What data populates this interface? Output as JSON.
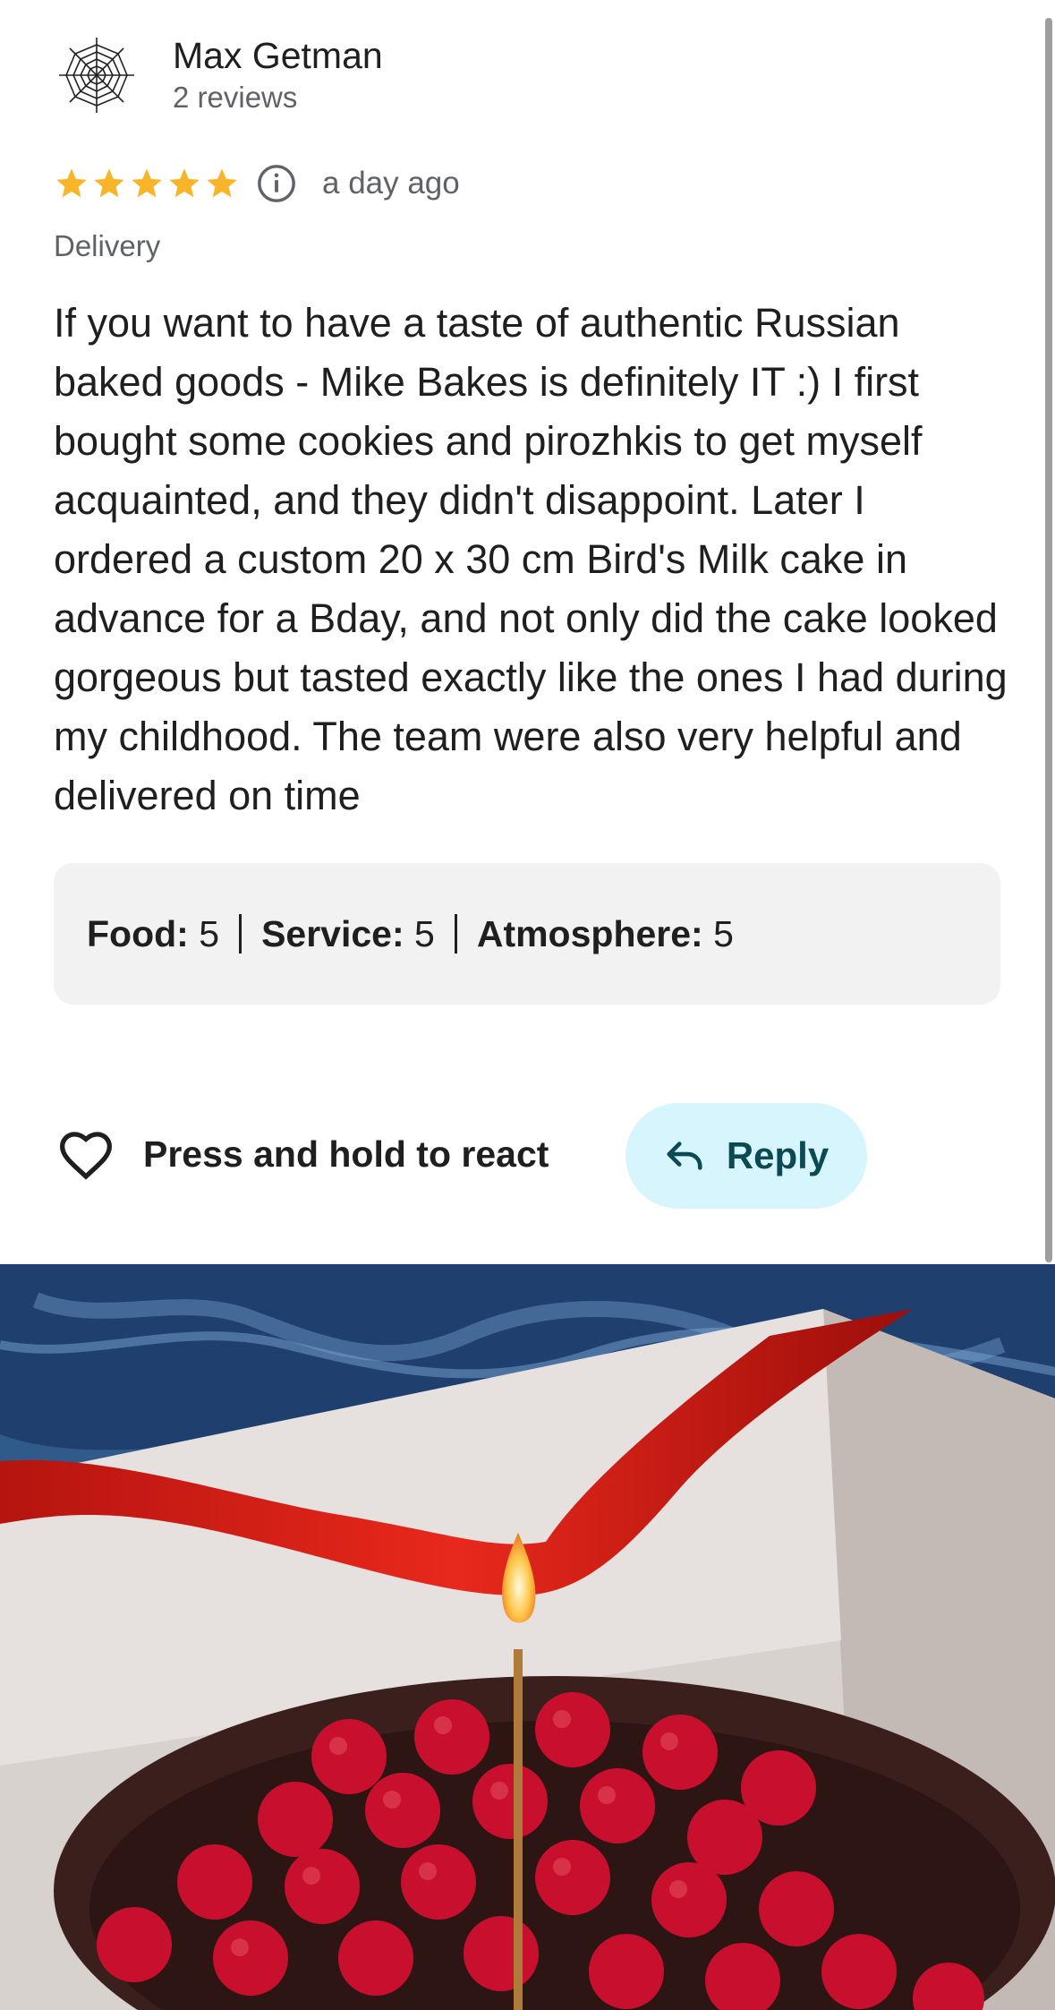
{
  "review": {
    "author": {
      "name": "Max Getman",
      "reviews_count": "2 reviews",
      "avatar_icon": "spider-web-icon"
    },
    "rating": {
      "stars": 5,
      "max_stars": 5,
      "star_color": "#F9B52A"
    },
    "info_icon": "info-icon",
    "time": "a day ago",
    "service_type": "Delivery",
    "text": "If you want to have a taste of authentic Russian baked goods - Mike Bakes is definitely IT :) I first bought some cookies and pirozhkis to get myself acquainted, and they didn't disappoint. Later I ordered a custom 20 x 30 cm Bird's Milk cake in advance for a Bday, and not only did the cake looked gorgeous but tasted exactly like the ones I had during my childhood. The team were also very helpful and delivered on time",
    "sub_ratings": [
      {
        "label": "Food:",
        "value": "5"
      },
      {
        "label": "Service:",
        "value": "5"
      },
      {
        "label": "Atmosphere:",
        "value": "5"
      }
    ]
  },
  "actions": {
    "react_label": "Press and hold to react",
    "react_icon": "heart-outline-icon",
    "reply_label": "Reply",
    "reply_icon": "reply-arrow-icon",
    "reply_bg": "#D6F5FC"
  }
}
